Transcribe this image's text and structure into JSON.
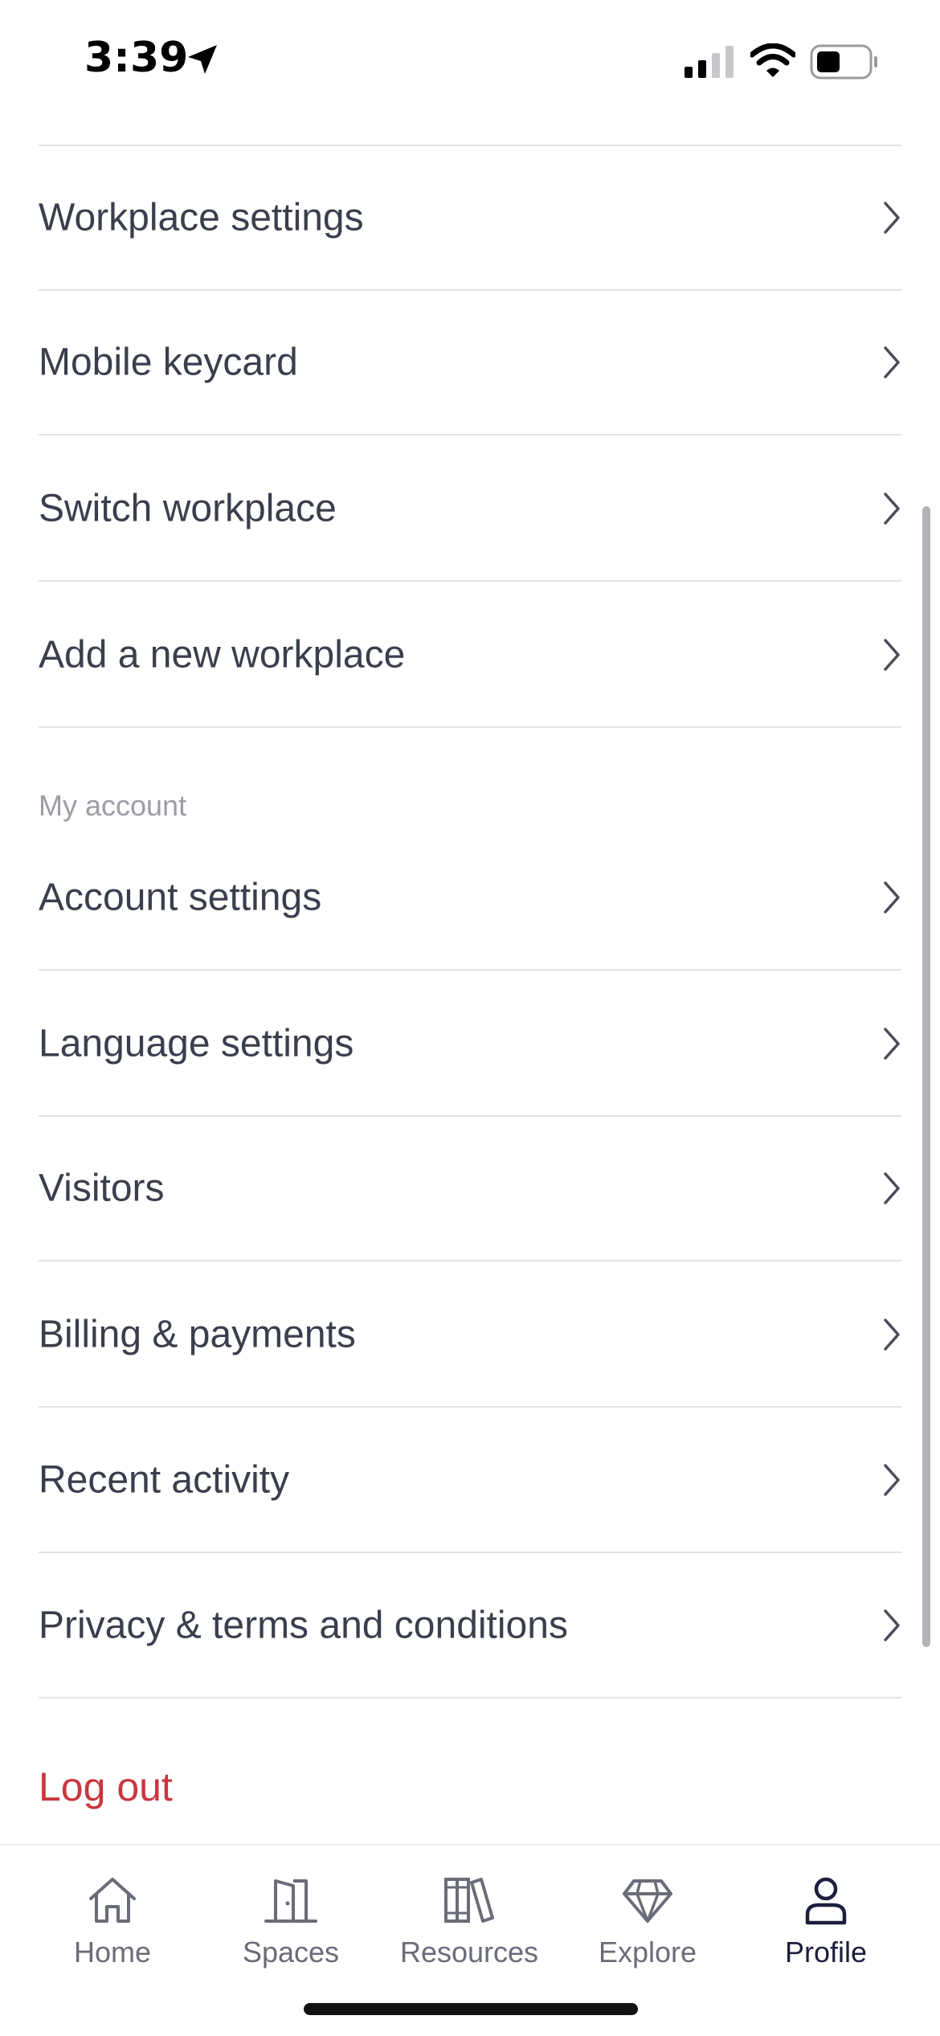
{
  "status_bar": {
    "time": "3:39"
  },
  "menu": {
    "workplace_items": [
      {
        "label": "Workplace settings"
      },
      {
        "label": "Mobile keycard"
      },
      {
        "label": "Switch workplace"
      },
      {
        "label": "Add a new workplace"
      }
    ],
    "account_section_title": "My account",
    "account_items": [
      {
        "label": "Account settings"
      },
      {
        "label": "Language settings"
      },
      {
        "label": "Visitors"
      },
      {
        "label": "Billing & payments"
      },
      {
        "label": "Recent activity"
      },
      {
        "label": "Privacy & terms and conditions"
      }
    ],
    "logout_label": "Log out"
  },
  "tab_bar": {
    "tabs": [
      {
        "label": "Home",
        "icon": "home-icon"
      },
      {
        "label": "Spaces",
        "icon": "door-icon"
      },
      {
        "label": "Resources",
        "icon": "books-icon"
      },
      {
        "label": "Explore",
        "icon": "diamond-icon"
      },
      {
        "label": "Profile",
        "icon": "person-icon"
      }
    ],
    "active_tab": "Profile"
  },
  "colors": {
    "text": "#3b3e4c",
    "section_header": "#9c9ca5",
    "logout": "#c8363e",
    "active_tab": "#1d1f3c",
    "inactive_tab": "#6a6c78"
  }
}
